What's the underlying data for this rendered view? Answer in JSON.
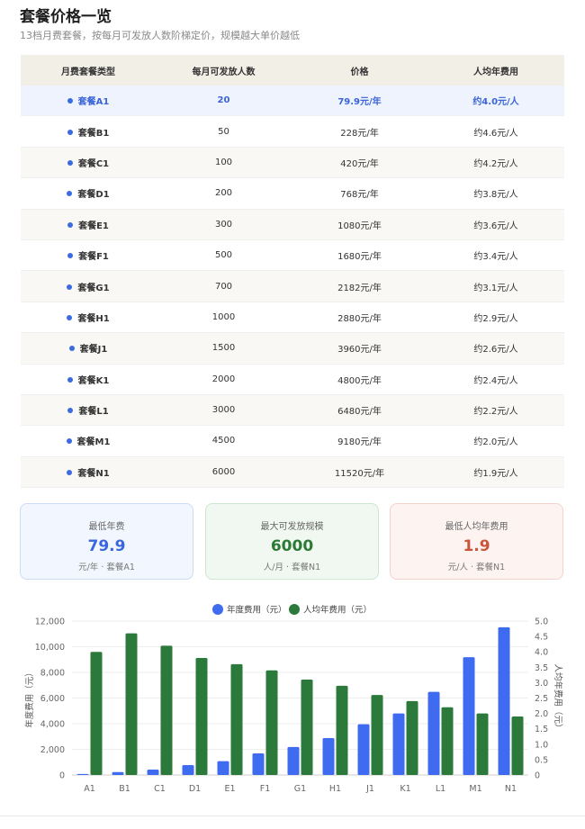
{
  "header": {
    "title": "套餐价格一览",
    "subtitle": "13档月费套餐，按每月可发放人数阶梯定价，规模越大单价越低"
  },
  "table": {
    "columns": [
      "月费套餐类型",
      "每月可发放人数",
      "价格",
      "人均年费用"
    ],
    "rows": [
      [
        "套餐A1",
        "20",
        "79.9元/年",
        "约4.0元/人"
      ],
      [
        "套餐B1",
        "50",
        "228元/年",
        "约4.6元/人"
      ],
      [
        "套餐C1",
        "100",
        "420元/年",
        "约4.2元/人"
      ],
      [
        "套餐D1",
        "200",
        "768元/年",
        "约3.8元/人"
      ],
      [
        "套餐E1",
        "300",
        "1080元/年",
        "约3.6元/人"
      ],
      [
        "套餐F1",
        "500",
        "1680元/年",
        "约3.4元/人"
      ],
      [
        "套餐G1",
        "700",
        "2182元/年",
        "约3.1元/人"
      ],
      [
        "套餐H1",
        "1000",
        "2880元/年",
        "约2.9元/人"
      ],
      [
        "套餐J1",
        "1500",
        "3960元/年",
        "约2.6元/人"
      ],
      [
        "套餐K1",
        "2000",
        "4800元/年",
        "约2.4元/人"
      ],
      [
        "套餐L1",
        "3000",
        "6480元/年",
        "约2.2元/人"
      ],
      [
        "套餐M1",
        "4500",
        "9180元/年",
        "约2.0元/人"
      ],
      [
        "套餐N1",
        "6000",
        "11520元/年",
        "约1.9元/人"
      ]
    ]
  },
  "cards": {
    "min_price": {
      "label": "最低年费",
      "value": "79.9",
      "sub": "元/年 · 套餐A1"
    },
    "max_scale": {
      "label": "最大可发放规模",
      "value": "6000",
      "sub": "人/月 · 套餐N1"
    },
    "min_per": {
      "label": "最低人均年费用",
      "value": "1.9",
      "sub": "元/人 · 套餐N1"
    }
  },
  "colors": {
    "blue": "#3e6bf0",
    "green": "#2b7a3b",
    "accent": "#3a64d8"
  },
  "chart_data": {
    "type": "bar",
    "categories": [
      "A1",
      "B1",
      "C1",
      "D1",
      "E1",
      "F1",
      "G1",
      "H1",
      "J1",
      "K1",
      "L1",
      "M1",
      "N1"
    ],
    "series": [
      {
        "name": "年度费用（元）",
        "axis": "left",
        "values": [
          79.9,
          228,
          420,
          768,
          1080,
          1680,
          2182,
          2880,
          3960,
          4800,
          6480,
          9180,
          11520
        ]
      },
      {
        "name": "人均年费用（元）",
        "axis": "right",
        "values": [
          4.0,
          4.6,
          4.2,
          3.8,
          3.6,
          3.4,
          3.1,
          2.9,
          2.6,
          2.4,
          2.2,
          2.0,
          1.9
        ]
      }
    ],
    "ylabel_left": "年度费用（元）",
    "ylabel_right": "人均年费用（元）",
    "ylim_left": [
      0,
      12000
    ],
    "ylim_right": [
      0,
      5.0
    ],
    "yticks_left": [
      "0",
      "2,000",
      "4,000",
      "6,000",
      "8,000",
      "10,000",
      "12,000"
    ],
    "yticks_right": [
      "0",
      "0.5",
      "1.0",
      "1.5",
      "2.0",
      "2.5",
      "3.0",
      "3.5",
      "4.0",
      "4.5",
      "5.0"
    ],
    "legend": "top-center",
    "grid": true
  }
}
